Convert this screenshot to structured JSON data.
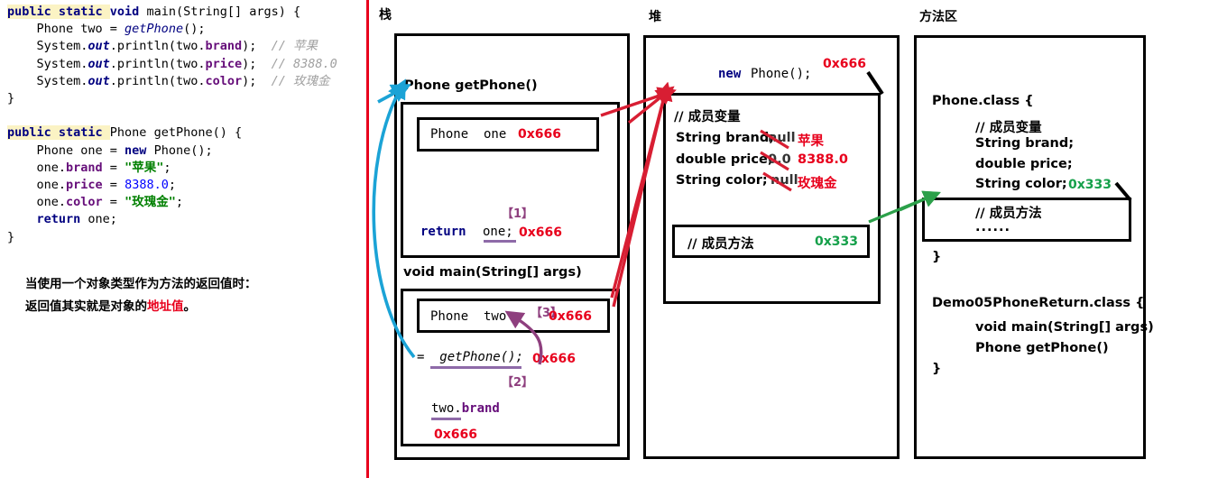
{
  "code": {
    "lines": [
      [
        {
          "t": "public static ",
          "c": "kw-hl"
        },
        {
          "t": "void ",
          "c": "kw"
        },
        {
          "t": "main(String[] args) {",
          "c": "plain"
        }
      ],
      [
        {
          "t": "    Phone two = ",
          "c": "plain"
        },
        {
          "t": "getPhone",
          "c": "ital"
        },
        {
          "t": "();",
          "c": "plain"
        }
      ],
      [
        {
          "t": "    System.",
          "c": "plain"
        },
        {
          "t": "out",
          "c": "ital-b"
        },
        {
          "t": ".println(two.",
          "c": "plain"
        },
        {
          "t": "brand",
          "c": "fld"
        },
        {
          "t": ");  ",
          "c": "plain"
        },
        {
          "t": "// 苹果",
          "c": "cmt"
        }
      ],
      [
        {
          "t": "    System.",
          "c": "plain"
        },
        {
          "t": "out",
          "c": "ital-b"
        },
        {
          "t": ".println(two.",
          "c": "plain"
        },
        {
          "t": "price",
          "c": "fld"
        },
        {
          "t": ");  ",
          "c": "plain"
        },
        {
          "t": "// 8388.0",
          "c": "cmt"
        }
      ],
      [
        {
          "t": "    System.",
          "c": "plain"
        },
        {
          "t": "out",
          "c": "ital-b"
        },
        {
          "t": ".println(two.",
          "c": "plain"
        },
        {
          "t": "color",
          "c": "fld"
        },
        {
          "t": ");  ",
          "c": "plain"
        },
        {
          "t": "// 玫瑰金",
          "c": "cmt"
        }
      ],
      [
        {
          "t": "}",
          "c": "plain"
        }
      ],
      [],
      [
        {
          "t": "public static ",
          "c": "kw-hl"
        },
        {
          "t": "Phone getPhone() {",
          "c": "plain"
        }
      ],
      [
        {
          "t": "    Phone one = ",
          "c": "plain"
        },
        {
          "t": "new ",
          "c": "kw"
        },
        {
          "t": "Phone();",
          "c": "plain"
        }
      ],
      [
        {
          "t": "    one.",
          "c": "plain"
        },
        {
          "t": "brand",
          "c": "fld"
        },
        {
          "t": " = ",
          "c": "plain"
        },
        {
          "t": "\"苹果\"",
          "c": "str"
        },
        {
          "t": ";",
          "c": "plain"
        }
      ],
      [
        {
          "t": "    one.",
          "c": "plain"
        },
        {
          "t": "price",
          "c": "fld"
        },
        {
          "t": " = ",
          "c": "plain"
        },
        {
          "t": "8388.0",
          "c": "num"
        },
        {
          "t": ";",
          "c": "plain"
        }
      ],
      [
        {
          "t": "    one.",
          "c": "plain"
        },
        {
          "t": "color",
          "c": "fld"
        },
        {
          "t": " = ",
          "c": "plain"
        },
        {
          "t": "\"玫瑰金\"",
          "c": "str"
        },
        {
          "t": ";",
          "c": "plain"
        }
      ],
      [
        {
          "t": "    ",
          "c": "plain"
        },
        {
          "t": "return ",
          "c": "kw"
        },
        {
          "t": "one;",
          "c": "plain"
        }
      ],
      [
        {
          "t": "}",
          "c": "plain"
        }
      ]
    ]
  },
  "note": {
    "line1": "当使用一个对象类型作为方法的返回值时：",
    "line2_prefix": "返回值其实就是对象的",
    "line2_red": "地址值",
    "line2_suffix": "。"
  },
  "stack": {
    "label": "栈",
    "frame_getphone_title": "Phone getPhone()",
    "var_one_type": "Phone  one",
    "var_one_addr": "0x666",
    "return_step": "【1】",
    "return_kw": "return",
    "return_var": "one;",
    "return_addr": "0x666",
    "frame_main_title": "void main(String[] args)",
    "var_two_type": "Phone  two",
    "var_two_step": "【3】",
    "var_two_addr": "0x666",
    "call_expr": "=  getPhone();",
    "call_addr": "0x666",
    "call_step": "【2】",
    "use_expr": "two.brand",
    "use_addr": "0x666"
  },
  "heap": {
    "label": "堆",
    "new_kw": "new",
    "new_expr": "Phone();",
    "new_addr": "0x666",
    "comment_fields": "// 成员变量",
    "fields": [
      {
        "decl": "String brand;",
        "default": "null",
        "value": "苹果"
      },
      {
        "decl": "double price;",
        "default": "0.0",
        "value": "8388.0"
      },
      {
        "decl": "String color;",
        "default": "null",
        "value": "玫瑰金"
      }
    ],
    "comment_methods": "// 成员方法",
    "methods_addr": "0x333"
  },
  "method_area": {
    "label": "方法区",
    "class1_header": "Phone.class {",
    "class1_comment_fields": "// 成员变量",
    "class1_fields": [
      "String brand;",
      "double price;",
      "String color;"
    ],
    "class1_methods_addr": "0x333",
    "class1_comment_methods": "// 成员方法",
    "class1_methods_ellipsis": "......",
    "class1_close": "}",
    "class2_header": "Demo05PhoneReturn.class {",
    "class2_members": [
      "void main(String[] args)",
      "Phone getPhone()"
    ],
    "class2_close": "}"
  },
  "colors": {
    "divider": "#e8001c",
    "address_red": "#e8001c",
    "address_green": "#15a04a",
    "step_purple": "#8e3f7e",
    "arrow_blue": "#1ba3d6",
    "arrow_red": "#d81e33",
    "arrow_green": "#2ca04a",
    "arrow_purple": "#8e3f7e",
    "highlight_yellow": "#fbf3c4"
  }
}
